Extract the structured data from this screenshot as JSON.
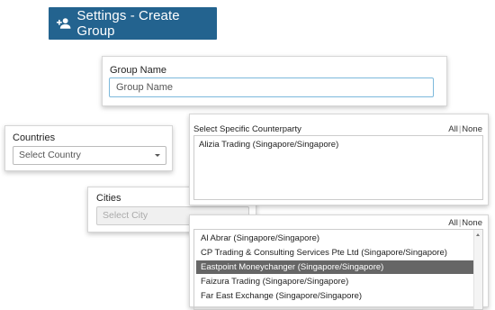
{
  "header": {
    "title": "Settings - Create Group",
    "icon": "add-user-icon",
    "bg_color": "#23638f"
  },
  "group_name": {
    "label": "Group Name",
    "placeholder": "Group Name",
    "value": ""
  },
  "countries": {
    "label": "Countries",
    "selected": "Select Country"
  },
  "cities": {
    "label": "Cities",
    "selected": "Select City",
    "disabled": true
  },
  "counterparty": {
    "label": "Select Specific Counterparty",
    "all_label": "All",
    "none_label": "None",
    "selected_items": [
      "Alizia Trading (Singapore/Singapore)"
    ]
  },
  "counterparty_list": {
    "all_label": "All",
    "none_label": "None",
    "items": [
      "Al Abrar (Singapore/Singapore)",
      "CP Trading & Consulting Services Pte Ltd (Singapore/Singapore)",
      "Eastpoint Moneychanger (Singapore/Singapore)",
      "Faizura Trading (Singapore/Singapore)",
      "Far East Exchange (Singapore/Singapore)"
    ],
    "highlighted_item": "Eastpoint Moneychanger (Singapore/Singapore)"
  }
}
